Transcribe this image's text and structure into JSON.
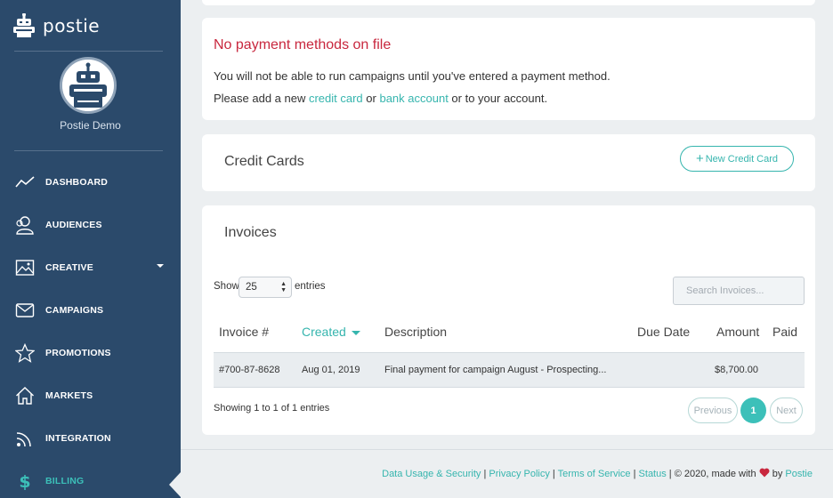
{
  "brand": {
    "name": "postie"
  },
  "profile": {
    "name": "Postie Demo"
  },
  "nav": [
    {
      "label": "DASHBOARD",
      "icon": "dashboard-icon"
    },
    {
      "label": "AUDIENCES",
      "icon": "audiences-icon"
    },
    {
      "label": "CREATIVE",
      "icon": "creative-icon"
    },
    {
      "label": "CAMPAIGNS",
      "icon": "campaigns-icon"
    },
    {
      "label": "PROMOTIONS",
      "icon": "promotions-icon"
    },
    {
      "label": "MARKETS",
      "icon": "markets-icon"
    },
    {
      "label": "INTEGRATION",
      "icon": "integration-icon"
    },
    {
      "label": "BILLING",
      "icon": "billing-icon"
    }
  ],
  "alert": {
    "title": "No payment methods on file",
    "line1": "You will not be able to run campaigns until you've entered a payment method.",
    "line2_pre": "Please add a new ",
    "credit_card_link": "credit card",
    "line2_mid": " or ",
    "bank_account_link": "bank account",
    "line2_post": " or to your account."
  },
  "credit_cards": {
    "title": "Credit Cards",
    "new_button": "New Credit Card"
  },
  "invoices": {
    "title": "Invoices",
    "show_label": "Show",
    "entries_value": "25",
    "entries_label": "entries",
    "search_placeholder": "Search Invoices...",
    "columns": [
      "Invoice #",
      "Created",
      "Description",
      "Due Date",
      "Amount",
      "Paid"
    ],
    "rows": [
      {
        "invoice": "#700-87-8628",
        "created": "Aug 01, 2019",
        "description": "Final payment for campaign August - Prospecting...",
        "due_date": "",
        "amount": "$8,700.00",
        "paid": ""
      }
    ],
    "showing": "Showing 1 to 1 of 1 entries",
    "pagination": {
      "previous": "Previous",
      "current": "1",
      "next": "Next"
    }
  },
  "footer": {
    "data_usage": "Data Usage & Security",
    "sep": " | ",
    "privacy": "Privacy Policy",
    "terms": "Terms of Service",
    "status": "Status",
    "copyright": "© 2020, made with",
    "by": "by",
    "postie": "Postie"
  },
  "colors": {
    "sidebar": "#2b4a6b",
    "accent": "#36b5ae",
    "alert": "#c8273e",
    "heart": "#c8273e"
  }
}
